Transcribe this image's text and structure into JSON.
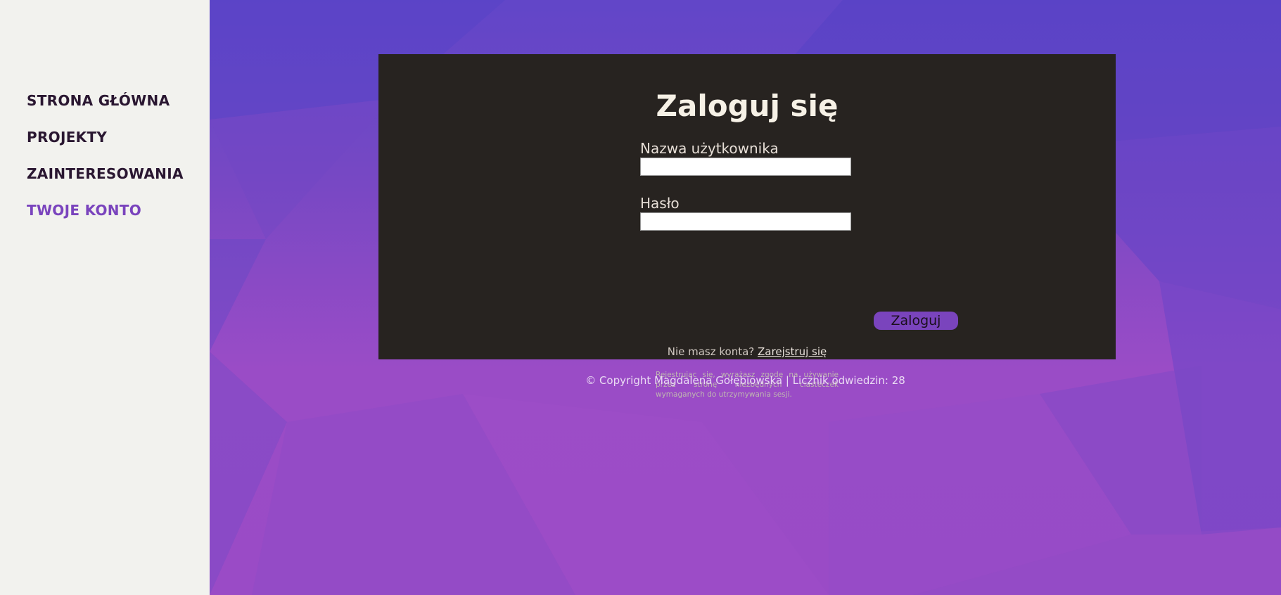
{
  "nav": {
    "items": [
      {
        "label": "STRONA GŁÓWNA"
      },
      {
        "label": "PROJEKTY"
      },
      {
        "label": "ZAINTERESOWANIA"
      },
      {
        "label": "TWOJE KONTO",
        "active": true
      }
    ]
  },
  "login": {
    "title": "Zaloguj się",
    "username_label": "Nazwa użytkownika",
    "username_value": "",
    "password_label": "Hasło",
    "password_value": "",
    "submit_label": "Zaloguj",
    "register_prompt": "Nie masz konta?",
    "register_link": "Zarejstruj się",
    "consent_text": "Rejestrując się, wyrażasz zgodę na używanie przez stronę niezbędnych ciasteczek wymaganych do utrzymywania sesji."
  },
  "footer": {
    "text": "© Copyright Magdalena Gołębiowska | Licznik odwiedzin: 28"
  },
  "colors": {
    "sidebar_bg": "#f2f2ee",
    "nav_text": "#2a1731",
    "accent": "#7a44bd",
    "card_bg": "#272320"
  }
}
